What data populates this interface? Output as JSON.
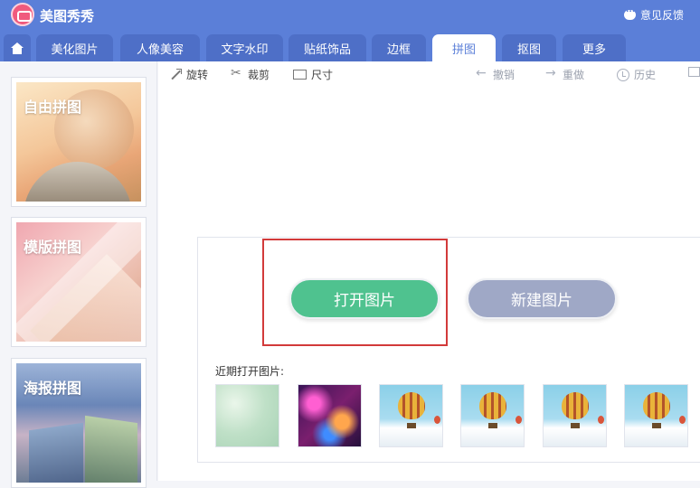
{
  "app": {
    "title": "美图秀秀",
    "feedback": "意见反馈"
  },
  "tabs": [
    {
      "label": "美化图片",
      "active": false
    },
    {
      "label": "人像美容",
      "active": false
    },
    {
      "label": "文字水印",
      "active": false
    },
    {
      "label": "贴纸饰品",
      "active": false
    },
    {
      "label": "边框",
      "active": false
    },
    {
      "label": "拼图",
      "active": true
    },
    {
      "label": "抠图",
      "active": false
    },
    {
      "label": "更多",
      "active": false
    }
  ],
  "sidebar": {
    "items": [
      {
        "label": "自由拼图"
      },
      {
        "label": "模版拼图"
      },
      {
        "label": "海报拼图"
      }
    ]
  },
  "toolbar": {
    "rotate": "旋转",
    "crop": "裁剪",
    "size": "尺寸",
    "undo": "撤销",
    "redo": "重做",
    "history": "历史"
  },
  "main": {
    "open_label": "打开图片",
    "new_label": "新建图片",
    "recent_label": "近期打开图片:"
  },
  "colors": {
    "header": "#5b7fd8",
    "open_button": "#4fc28f",
    "new_button": "#9fa8c6",
    "highlight": "#d23a3a"
  }
}
